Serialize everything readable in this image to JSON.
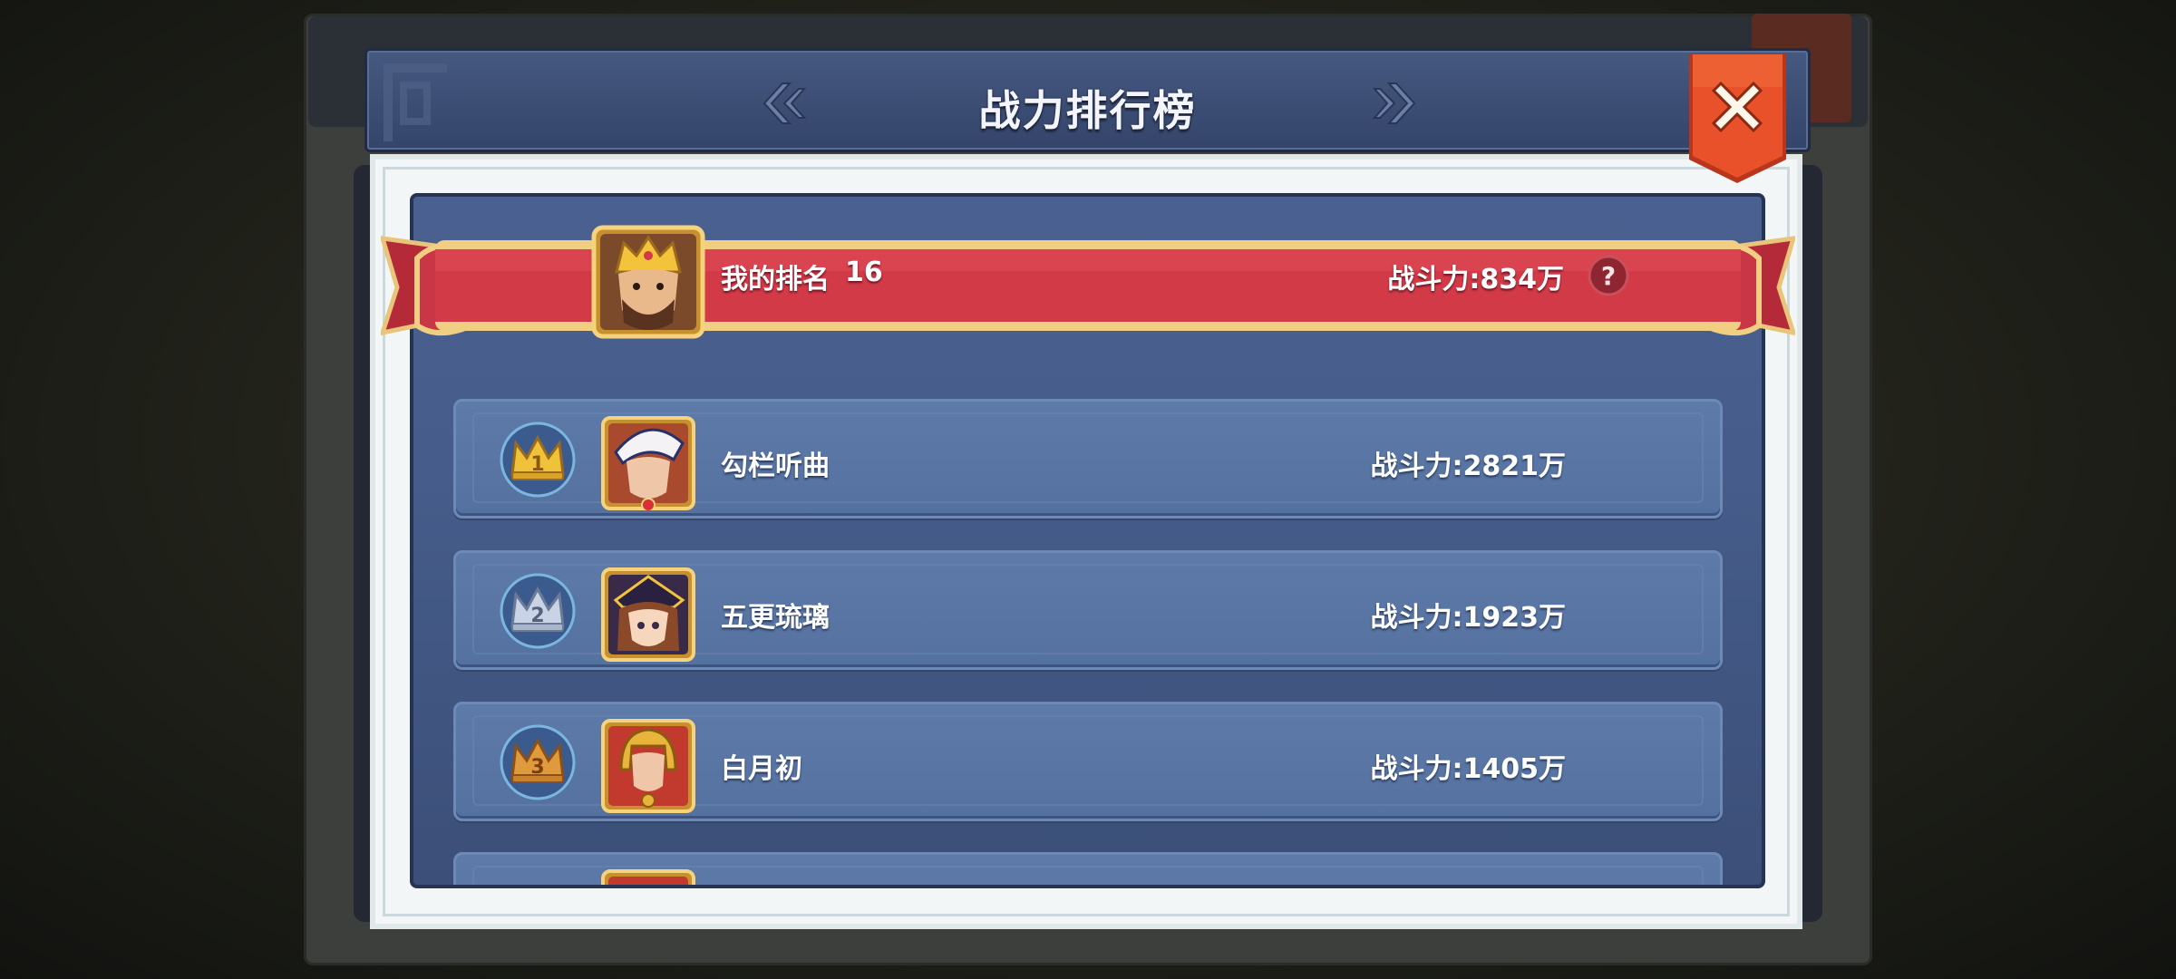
{
  "header": {
    "title": "战力排行榜"
  },
  "my_rank": {
    "label": "我的排名",
    "rank": "16",
    "power_label": "战斗力:",
    "power_value": "834万"
  },
  "rows": [
    {
      "rank": "1",
      "name": "勾栏听曲",
      "power_label": "战斗力:",
      "power_value": "2821万",
      "badge_color": "#f0c23a"
    },
    {
      "rank": "2",
      "name": "五更琉璃",
      "power_label": "战斗力:",
      "power_value": "1923万",
      "badge_color": "#c9d3e6"
    },
    {
      "rank": "3",
      "name": "白月初",
      "power_label": "战斗力:",
      "power_value": "1405万",
      "badge_color": "#e09a3e"
    }
  ],
  "colors": {
    "ribbon_red": "#d23a48",
    "ribbon_gold": "#f0cf82",
    "close_orange": "#e8512a",
    "panel_blue": "#4a6090"
  },
  "icons": {
    "arrow_left": "double-chevron-left-icon",
    "arrow_right": "double-chevron-right-icon",
    "close": "close-x-icon",
    "help": "question-mark-icon"
  }
}
